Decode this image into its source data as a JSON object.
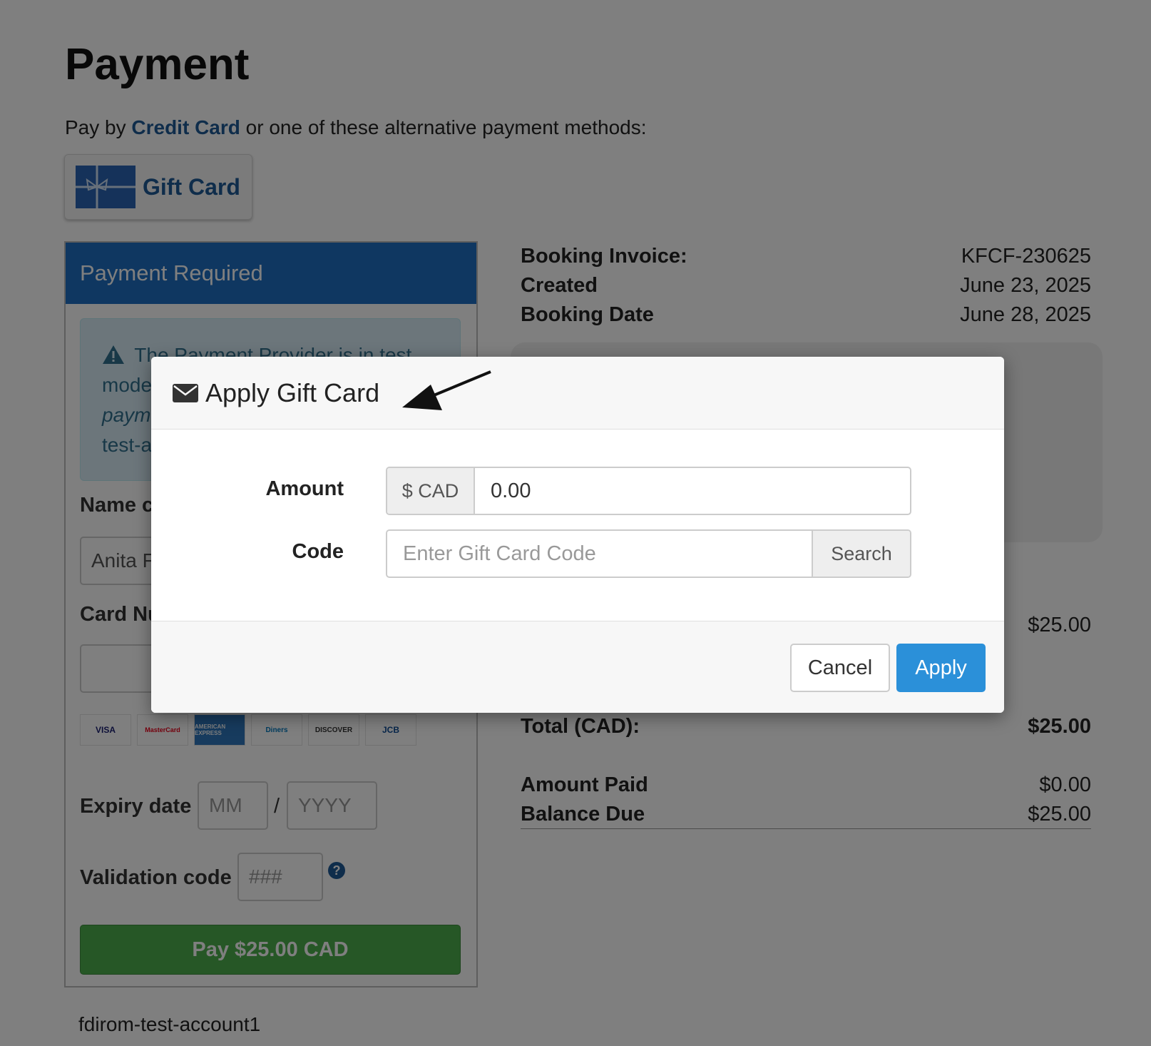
{
  "page": {
    "title": "Payment",
    "intro_prefix": "Pay by",
    "intro_link": "Credit Card",
    "intro_suffix": "or one of these alternative payment methods:",
    "gift_card_button": "Gift Card"
  },
  "panel": {
    "header": "Payment Required",
    "alert_line1": "The Payment Provider is in test",
    "alert_line2": "mode",
    "alert_line3": "paym",
    "alert_line4": "test-a",
    "name_label": "Name c",
    "name_value": "Anita F",
    "card_number_label": "Card Nu",
    "card_brands": [
      "VISA",
      "MasterCard",
      "AMERICAN EXPRESS",
      "Diners",
      "DISCOVER",
      "JCB"
    ],
    "expiry_label": "Expiry date",
    "expiry_month_placeholder": "MM",
    "expiry_sep": "/",
    "expiry_year_placeholder": "YYYY",
    "validation_label": "Validation code",
    "validation_placeholder": "###",
    "help_icon": "?",
    "pay_button": "Pay $25.00 CAD"
  },
  "account": "fdirom-test-account1",
  "invoice": {
    "rows": [
      {
        "k": "Booking Invoice:",
        "v": "KFCF-230625"
      },
      {
        "k": "Created",
        "v": "June 23, 2025"
      },
      {
        "k": "Booking Date",
        "v": "June 28, 2025"
      }
    ],
    "line_amount": "$25.00",
    "total_label": "Total (CAD):",
    "total_value": "$25.00",
    "paid_label": "Amount Paid",
    "paid_value": "$0.00",
    "balance_label": "Balance Due",
    "balance_value": "$25.00"
  },
  "modal": {
    "title": "Apply Gift Card",
    "icon": "envelope-icon",
    "amount_label": "Amount",
    "amount_addon": "$ CAD",
    "amount_value": "0.00",
    "code_label": "Code",
    "code_placeholder": "Enter Gift Card Code",
    "search_button": "Search",
    "cancel_button": "Cancel",
    "apply_button": "Apply"
  },
  "colors": {
    "link": "#1f5a96",
    "panel_header": "#1f6fc2",
    "pay_button": "#4cae4c",
    "apply_button": "#2b90d9"
  }
}
